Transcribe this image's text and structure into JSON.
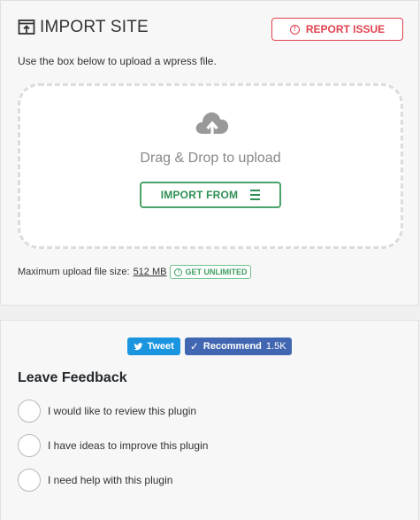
{
  "import": {
    "title": "IMPORT SITE",
    "report_label": "REPORT ISSUE",
    "instruction": "Use the box below to upload a wpress file.",
    "drag_text": "Drag & Drop to upload",
    "import_from_label": "IMPORT FROM",
    "max_size_label": "Maximum upload file size:",
    "max_size_value": "512 MB",
    "get_unlimited_label": "GET UNLIMITED"
  },
  "social": {
    "tweet_label": "Tweet",
    "recommend_label": "Recommend",
    "recommend_count": "1.5K"
  },
  "feedback": {
    "title": "Leave Feedback",
    "options": [
      {
        "label": "I would like to review this plugin"
      },
      {
        "label": "I have ideas to improve this plugin"
      },
      {
        "label": "I need help with this plugin"
      }
    ]
  },
  "colors": {
    "accent_red": "#e2414e",
    "accent_green": "#4aa369",
    "twitter_blue": "#1b95e0",
    "facebook_blue": "#4267b2"
  }
}
